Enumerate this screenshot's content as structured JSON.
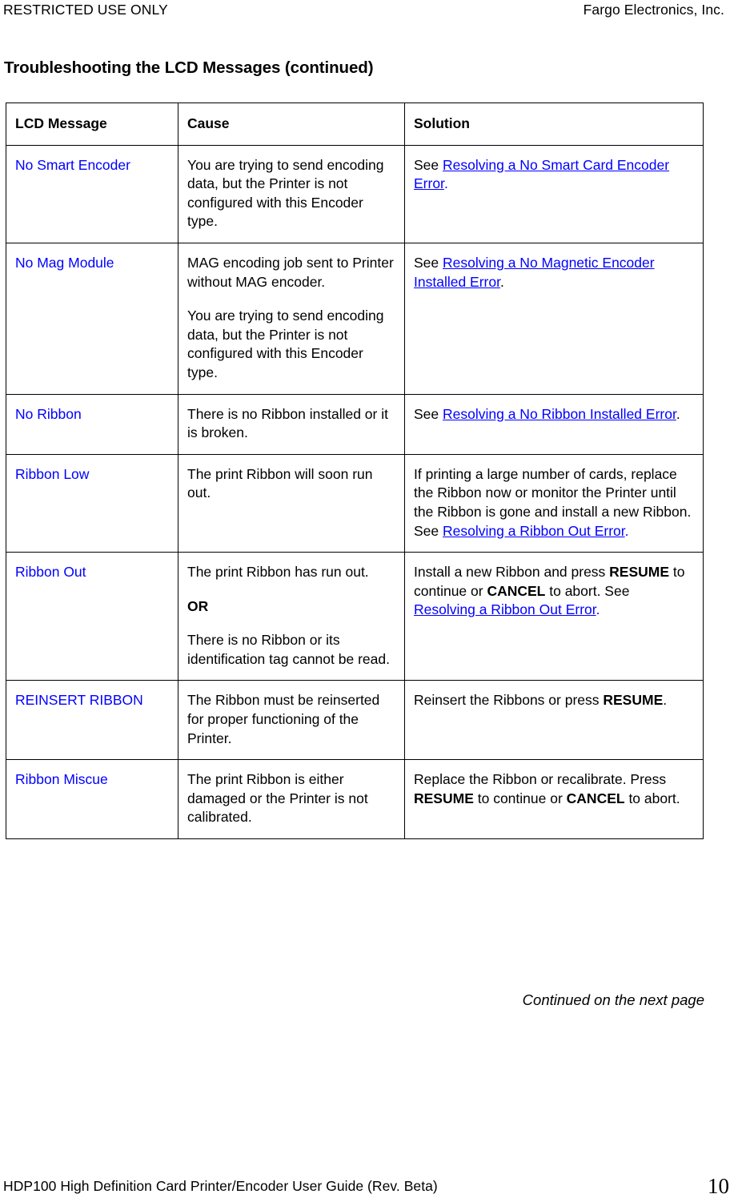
{
  "running_header": {
    "left": "RESTRICTED USE ONLY",
    "right": "Fargo Electronics, Inc."
  },
  "section_title": "Troubleshooting the LCD Messages (continued)",
  "table": {
    "columns": [
      "LCD Message",
      "Cause",
      "Solution"
    ],
    "rows": [
      {
        "message": "No Smart Encoder",
        "cause": [
          "You are trying to send encoding data, but the Printer is not configured with this Encoder type."
        ],
        "solution_parts": [
          {
            "type": "text",
            "text": "See "
          },
          {
            "type": "link",
            "text": "Resolving a No Smart Card Encoder Error"
          },
          {
            "type": "link-period",
            "text": "."
          }
        ]
      },
      {
        "message": "No Mag Module",
        "cause": [
          "MAG encoding job sent to Printer without MAG encoder.",
          "You are trying to send encoding data, but the Printer is not configured with this Encoder type."
        ],
        "solution_parts": [
          {
            "type": "text",
            "text": "See "
          },
          {
            "type": "link",
            "text": "Resolving a No Magnetic Encoder Installed Error"
          },
          {
            "type": "text",
            "text": "."
          }
        ]
      },
      {
        "message": "No Ribbon",
        "cause": [
          "There is no Ribbon installed or it is broken."
        ],
        "solution_parts": [
          {
            "type": "text",
            "text": "See "
          },
          {
            "type": "link",
            "text": "Resolving a No Ribbon Installed Error"
          },
          {
            "type": "text",
            "text": "."
          }
        ]
      },
      {
        "message": "Ribbon Low",
        "cause": [
          "The print Ribbon will soon run out."
        ],
        "solution_parts": [
          {
            "type": "text",
            "text": "If printing a large number of cards, replace the Ribbon now or monitor the Printer until the Ribbon is gone and install a new Ribbon. See "
          },
          {
            "type": "link",
            "text": "Resolving a Ribbon Out Error"
          },
          {
            "type": "link-period",
            "text": "."
          }
        ]
      },
      {
        "message": "Ribbon Out",
        "cause": [
          "The print Ribbon has run out.",
          "OR",
          "There is no Ribbon or its identification tag cannot be read."
        ],
        "solution_parts": [
          {
            "type": "text",
            "text": "Install a new Ribbon and press "
          },
          {
            "type": "bold",
            "text": "RESUME"
          },
          {
            "type": "text",
            "text": " to continue or "
          },
          {
            "type": "bold",
            "text": "CANCEL"
          },
          {
            "type": "text",
            "text": " to abort. See "
          },
          {
            "type": "link",
            "text": "Resolving a Ribbon Out Error"
          },
          {
            "type": "link-period",
            "text": "."
          }
        ]
      },
      {
        "message": "REINSERT RIBBON",
        "cause": [
          "The Ribbon must be reinserted for proper functioning of the Printer."
        ],
        "solution_parts": [
          {
            "type": "text",
            "text": "Reinsert the Ribbons or press "
          },
          {
            "type": "bold",
            "text": "RESUME"
          },
          {
            "type": "text",
            "text": "."
          }
        ]
      },
      {
        "message": "Ribbon Miscue",
        "cause": [
          "The print Ribbon is either damaged or the Printer is not calibrated."
        ],
        "solution_parts": [
          {
            "type": "text",
            "text": "Replace the Ribbon or recalibrate. Press "
          },
          {
            "type": "bold",
            "text": "RESUME"
          },
          {
            "type": "text",
            "text": " to continue or "
          },
          {
            "type": "bold",
            "text": "CANCEL"
          },
          {
            "type": "text",
            "text": " to abort."
          }
        ]
      }
    ]
  },
  "continued_note": "Continued on the next page",
  "running_footer": {
    "text": "HDP100 High Definition Card Printer/Encoder User Guide (Rev. Beta)",
    "page_number": "10"
  },
  "colors": {
    "link": "#0000FF",
    "message": "#0000FF",
    "text": "#000000",
    "border": "#000000",
    "background": "#FFFFFF"
  }
}
